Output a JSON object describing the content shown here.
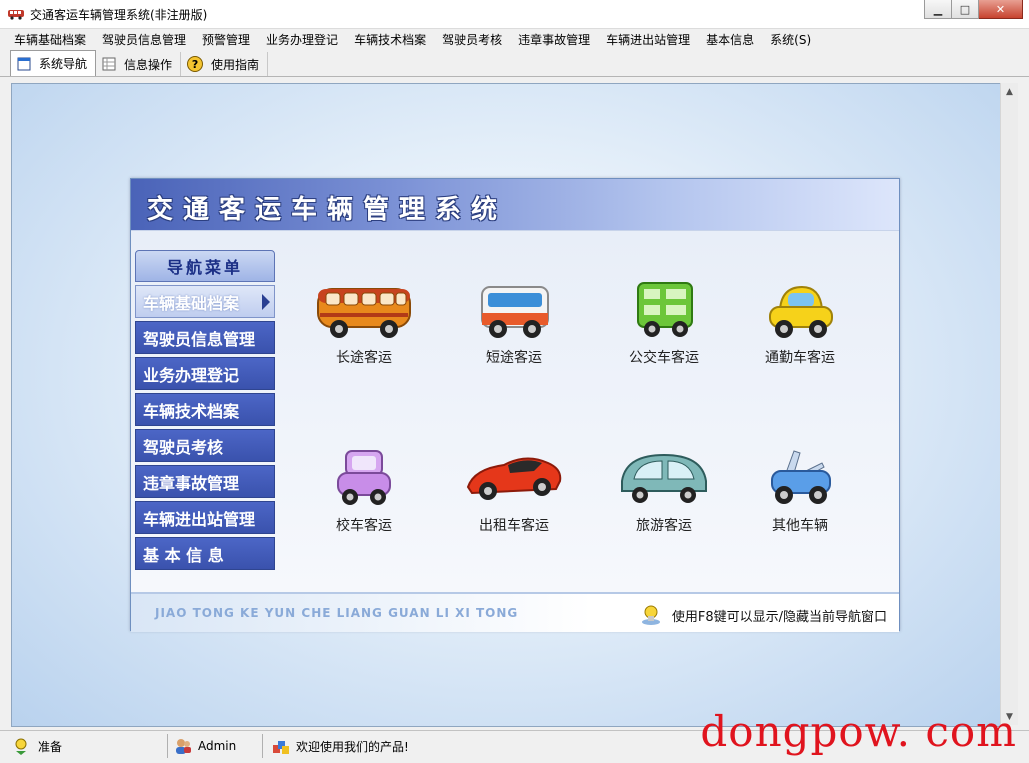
{
  "window": {
    "title": "交通客运车辆管理系统(非注册版)",
    "minimize_glyph": "▁",
    "maximize_glyph": "□",
    "close_glyph": "✕"
  },
  "menu": [
    "车辆基础档案",
    "驾驶员信息管理",
    "预警管理",
    "业务办理登记",
    "车辆技术档案",
    "驾驶员考核",
    "违章事故管理",
    "车辆进出站管理",
    "基本信息",
    "系统(S)"
  ],
  "tabs": [
    {
      "label": "系统导航",
      "icon": "window-icon",
      "active": true
    },
    {
      "label": "信息操作",
      "icon": "grid-icon",
      "active": false
    },
    {
      "label": "使用指南",
      "icon": "help-icon",
      "glyph": "?",
      "active": false
    }
  ],
  "panel": {
    "title": "交通客运车辆管理系统",
    "footer_en": "JIAO TONG KE YUN CHE LIANG GUAN LI XI TONG",
    "footer_tip": "使用F8键可以显示/隐藏当前导航窗口"
  },
  "nav": {
    "header": "导航菜单",
    "items": [
      "车辆基础档案",
      "驾驶员信息管理",
      "业务办理登记",
      "车辆技术档案",
      "驾驶员考核",
      "违章事故管理",
      "车辆进出站管理",
      "基 本 信 息"
    ]
  },
  "vehicles": [
    {
      "label": "长途客运",
      "icon": "coach-bus-icon"
    },
    {
      "label": "短途客运",
      "icon": "minibus-icon"
    },
    {
      "label": "公交车客运",
      "icon": "city-bus-icon"
    },
    {
      "label": "通勤车客运",
      "icon": "commuter-car-icon"
    },
    {
      "label": "校车客运",
      "icon": "school-van-icon"
    },
    {
      "label": "出租车客运",
      "icon": "sports-car-icon"
    },
    {
      "label": "旅游客运",
      "icon": "touring-car-icon"
    },
    {
      "label": "其他车辆",
      "icon": "other-car-icon"
    }
  ],
  "status": {
    "ready": "准备",
    "user": "Admin",
    "welcome": "欢迎使用我们的产品!"
  },
  "watermark": "dongpow. com",
  "colors": {
    "nav_blue": "#3a52ad",
    "header_blue": "#4a63b8",
    "close_red": "#c7432f"
  }
}
